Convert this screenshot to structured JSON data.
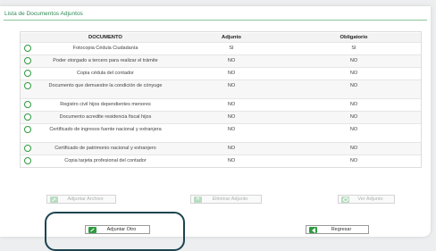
{
  "panel": {
    "title": "Lista de Documentos Adjuntos"
  },
  "table": {
    "headers": [
      "DOCUMENTO",
      "Adjunto",
      "Obligatorio"
    ],
    "rows": [
      {
        "documento": "Fotocopia Cédula Ciudadanía",
        "adjunto": "SI",
        "obligatorio": "SI"
      },
      {
        "documento": "Poder otorgado a tercero para realizar el trámite",
        "adjunto": "NO",
        "obligatorio": "NO"
      },
      {
        "documento": "Copia cédula del contador",
        "adjunto": "NO",
        "obligatorio": "NO"
      },
      {
        "documento": "Documento que demuestre la condición de cónyuge",
        "adjunto": "NO",
        "obligatorio": "NO"
      },
      {
        "documento": "Registro civil hijos dependientes menores",
        "adjunto": "NO",
        "obligatorio": "NO"
      },
      {
        "documento": "Documento acredite residencia fiscal hijos",
        "adjunto": "NO",
        "obligatorio": "NO"
      },
      {
        "documento": "Certificado de ingresos fuente nacional y extranjera",
        "adjunto": "NO",
        "obligatorio": "NO"
      },
      {
        "documento": "Certificado de patrimonio nacional y extranjero",
        "adjunto": "NO",
        "obligatorio": "NO"
      },
      {
        "documento": "Copia tarjeta profesional del contador",
        "adjunto": "NO",
        "obligatorio": "NO"
      }
    ]
  },
  "buttons": {
    "adjuntar_archivo": "Adjuntar Archivo",
    "eliminar_adjunto": "Eliminar Adjunto",
    "ver_adjunto": "Ver Adjunto",
    "adjuntar_otro": "Adjuntar Otro",
    "regresar": "Regresar"
  },
  "icons": {
    "adjuntar_archivo": "pencil-icon",
    "eliminar_adjunto": "close-icon",
    "ver_adjunto": "eye-icon",
    "adjuntar_otro": "pencil-icon",
    "regresar": "arrow-left-icon"
  },
  "colors": {
    "accent": "#2e9b3e",
    "title": "#2e8b57",
    "highlight": "#1d4450"
  }
}
